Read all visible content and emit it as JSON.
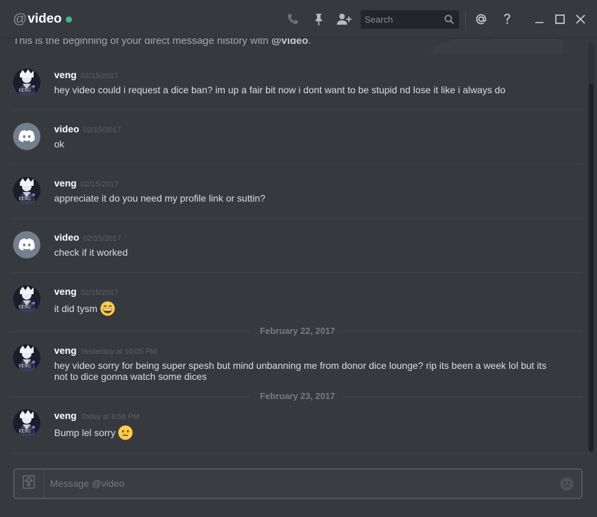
{
  "header": {
    "at_symbol": "@",
    "channel_name": "video",
    "status_color": "#43b581",
    "icons": [
      "call-icon",
      "pin-icon",
      "add-friend-icon",
      "mention-icon",
      "help-icon",
      "minimize-icon",
      "maximize-icon",
      "close-icon"
    ],
    "search_placeholder": "Search"
  },
  "intro": {
    "prefix": "This is the beginning of your direct message history with ",
    "mention": "@video",
    "suffix": "."
  },
  "messages": [
    {
      "author": "veng",
      "timestamp": "02/15/2017",
      "text": "hey video could i request a dice ban? im up a fair bit now i dont want to be stupid nd lose it like i always do",
      "emoji": ""
    },
    {
      "author": "video",
      "timestamp": "02/15/2017",
      "text": "ok",
      "emoji": ""
    },
    {
      "author": "veng",
      "timestamp": "02/15/2017",
      "text": "appreciate it do you need my profile link or suttin?",
      "emoji": ""
    },
    {
      "author": "video",
      "timestamp": "02/15/2017",
      "text": "check if it worked",
      "emoji": ""
    },
    {
      "author": "veng",
      "timestamp": "02/15/2017",
      "text": "it did tysm",
      "emoji": "grinning-emoji"
    },
    {
      "author": "veng",
      "timestamp": "Yesterday at 10:05 PM",
      "text": "hey video sorry for being super spesh but mind unbanning me from donor dice lounge? rip its been a week lol but its not to dice gonna watch some dices",
      "emoji": ""
    },
    {
      "author": "veng",
      "timestamp": "Today at 8:58 PM",
      "text": "Bump lel sorry",
      "emoji": "frowning-emoji"
    }
  ],
  "dividers": [
    {
      "label": "February 22, 2017"
    },
    {
      "label": "February 23, 2017"
    }
  ],
  "composer": {
    "placeholder": "Message @video",
    "icons": [
      "upload-icon",
      "emoji-picker-icon"
    ]
  }
}
